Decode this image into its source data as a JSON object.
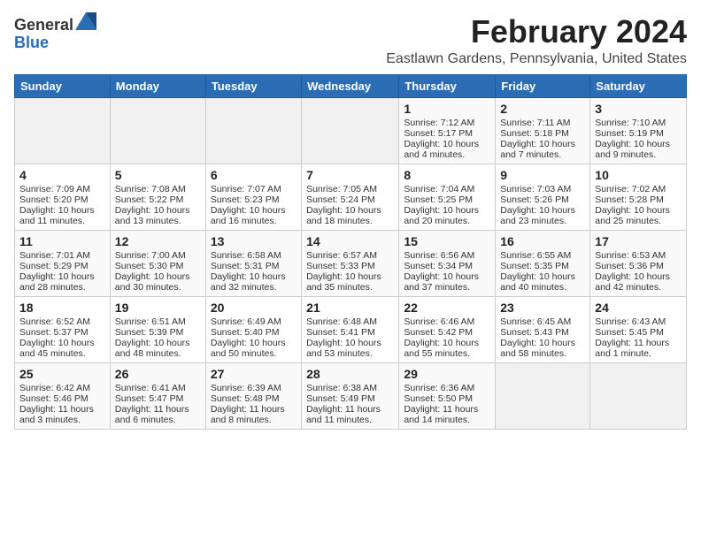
{
  "header": {
    "logo_general": "General",
    "logo_blue": "Blue",
    "month_year": "February 2024",
    "location": "Eastlawn Gardens, Pennsylvania, United States"
  },
  "days_of_week": [
    "Sunday",
    "Monday",
    "Tuesday",
    "Wednesday",
    "Thursday",
    "Friday",
    "Saturday"
  ],
  "weeks": [
    [
      {
        "day": "",
        "content": ""
      },
      {
        "day": "",
        "content": ""
      },
      {
        "day": "",
        "content": ""
      },
      {
        "day": "",
        "content": ""
      },
      {
        "day": "1",
        "content": "Sunrise: 7:12 AM\nSunset: 5:17 PM\nDaylight: 10 hours\nand 4 minutes."
      },
      {
        "day": "2",
        "content": "Sunrise: 7:11 AM\nSunset: 5:18 PM\nDaylight: 10 hours\nand 7 minutes."
      },
      {
        "day": "3",
        "content": "Sunrise: 7:10 AM\nSunset: 5:19 PM\nDaylight: 10 hours\nand 9 minutes."
      }
    ],
    [
      {
        "day": "4",
        "content": "Sunrise: 7:09 AM\nSunset: 5:20 PM\nDaylight: 10 hours\nand 11 minutes."
      },
      {
        "day": "5",
        "content": "Sunrise: 7:08 AM\nSunset: 5:22 PM\nDaylight: 10 hours\nand 13 minutes."
      },
      {
        "day": "6",
        "content": "Sunrise: 7:07 AM\nSunset: 5:23 PM\nDaylight: 10 hours\nand 16 minutes."
      },
      {
        "day": "7",
        "content": "Sunrise: 7:05 AM\nSunset: 5:24 PM\nDaylight: 10 hours\nand 18 minutes."
      },
      {
        "day": "8",
        "content": "Sunrise: 7:04 AM\nSunset: 5:25 PM\nDaylight: 10 hours\nand 20 minutes."
      },
      {
        "day": "9",
        "content": "Sunrise: 7:03 AM\nSunset: 5:26 PM\nDaylight: 10 hours\nand 23 minutes."
      },
      {
        "day": "10",
        "content": "Sunrise: 7:02 AM\nSunset: 5:28 PM\nDaylight: 10 hours\nand 25 minutes."
      }
    ],
    [
      {
        "day": "11",
        "content": "Sunrise: 7:01 AM\nSunset: 5:29 PM\nDaylight: 10 hours\nand 28 minutes."
      },
      {
        "day": "12",
        "content": "Sunrise: 7:00 AM\nSunset: 5:30 PM\nDaylight: 10 hours\nand 30 minutes."
      },
      {
        "day": "13",
        "content": "Sunrise: 6:58 AM\nSunset: 5:31 PM\nDaylight: 10 hours\nand 32 minutes."
      },
      {
        "day": "14",
        "content": "Sunrise: 6:57 AM\nSunset: 5:33 PM\nDaylight: 10 hours\nand 35 minutes."
      },
      {
        "day": "15",
        "content": "Sunrise: 6:56 AM\nSunset: 5:34 PM\nDaylight: 10 hours\nand 37 minutes."
      },
      {
        "day": "16",
        "content": "Sunrise: 6:55 AM\nSunset: 5:35 PM\nDaylight: 10 hours\nand 40 minutes."
      },
      {
        "day": "17",
        "content": "Sunrise: 6:53 AM\nSunset: 5:36 PM\nDaylight: 10 hours\nand 42 minutes."
      }
    ],
    [
      {
        "day": "18",
        "content": "Sunrise: 6:52 AM\nSunset: 5:37 PM\nDaylight: 10 hours\nand 45 minutes."
      },
      {
        "day": "19",
        "content": "Sunrise: 6:51 AM\nSunset: 5:39 PM\nDaylight: 10 hours\nand 48 minutes."
      },
      {
        "day": "20",
        "content": "Sunrise: 6:49 AM\nSunset: 5:40 PM\nDaylight: 10 hours\nand 50 minutes."
      },
      {
        "day": "21",
        "content": "Sunrise: 6:48 AM\nSunset: 5:41 PM\nDaylight: 10 hours\nand 53 minutes."
      },
      {
        "day": "22",
        "content": "Sunrise: 6:46 AM\nSunset: 5:42 PM\nDaylight: 10 hours\nand 55 minutes."
      },
      {
        "day": "23",
        "content": "Sunrise: 6:45 AM\nSunset: 5:43 PM\nDaylight: 10 hours\nand 58 minutes."
      },
      {
        "day": "24",
        "content": "Sunrise: 6:43 AM\nSunset: 5:45 PM\nDaylight: 11 hours\nand 1 minute."
      }
    ],
    [
      {
        "day": "25",
        "content": "Sunrise: 6:42 AM\nSunset: 5:46 PM\nDaylight: 11 hours\nand 3 minutes."
      },
      {
        "day": "26",
        "content": "Sunrise: 6:41 AM\nSunset: 5:47 PM\nDaylight: 11 hours\nand 6 minutes."
      },
      {
        "day": "27",
        "content": "Sunrise: 6:39 AM\nSunset: 5:48 PM\nDaylight: 11 hours\nand 8 minutes."
      },
      {
        "day": "28",
        "content": "Sunrise: 6:38 AM\nSunset: 5:49 PM\nDaylight: 11 hours\nand 11 minutes."
      },
      {
        "day": "29",
        "content": "Sunrise: 6:36 AM\nSunset: 5:50 PM\nDaylight: 11 hours\nand 14 minutes."
      },
      {
        "day": "",
        "content": ""
      },
      {
        "day": "",
        "content": ""
      }
    ]
  ]
}
